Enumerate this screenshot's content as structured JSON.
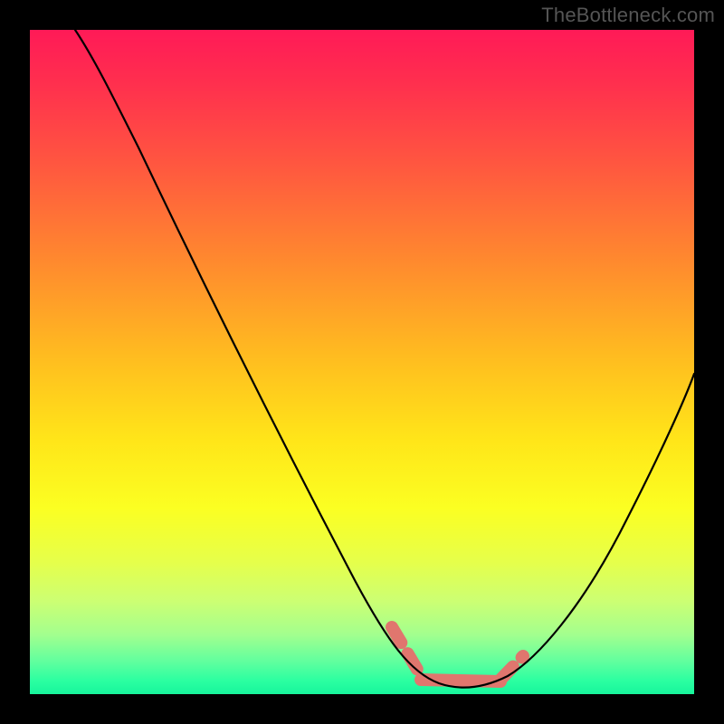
{
  "watermark": "TheBottleneck.com",
  "colors": {
    "black": "#000000",
    "gradient": [
      "#ff1a57",
      "#ff2f4e",
      "#ff5640",
      "#ff8a2e",
      "#ffbf1f",
      "#ffe619",
      "#fbff22",
      "#e6ff4a",
      "#ccff73",
      "#a3ff8e",
      "#62ff9e",
      "#2bffa1",
      "#17f59c"
    ],
    "valley_highlight": "#e0766e"
  },
  "chart_data": {
    "type": "line",
    "title": "",
    "xlabel": "",
    "ylabel": "",
    "xlim": [
      0,
      100
    ],
    "ylim": [
      0,
      100
    ],
    "series": [
      {
        "name": "bottleneck-curve",
        "x": [
          0,
          5,
          10,
          15,
          20,
          25,
          30,
          35,
          40,
          45,
          50,
          55,
          58,
          60,
          62,
          65,
          68,
          70,
          75,
          80,
          85,
          90,
          95,
          100
        ],
        "y": [
          100,
          92,
          84,
          76,
          68,
          59,
          50,
          41,
          32,
          24,
          16,
          8,
          4,
          2,
          1,
          1,
          1,
          2,
          6,
          12,
          21,
          31,
          42,
          53
        ]
      }
    ],
    "valley_highlight": {
      "x_range": [
        55,
        72
      ],
      "y": 1
    }
  }
}
